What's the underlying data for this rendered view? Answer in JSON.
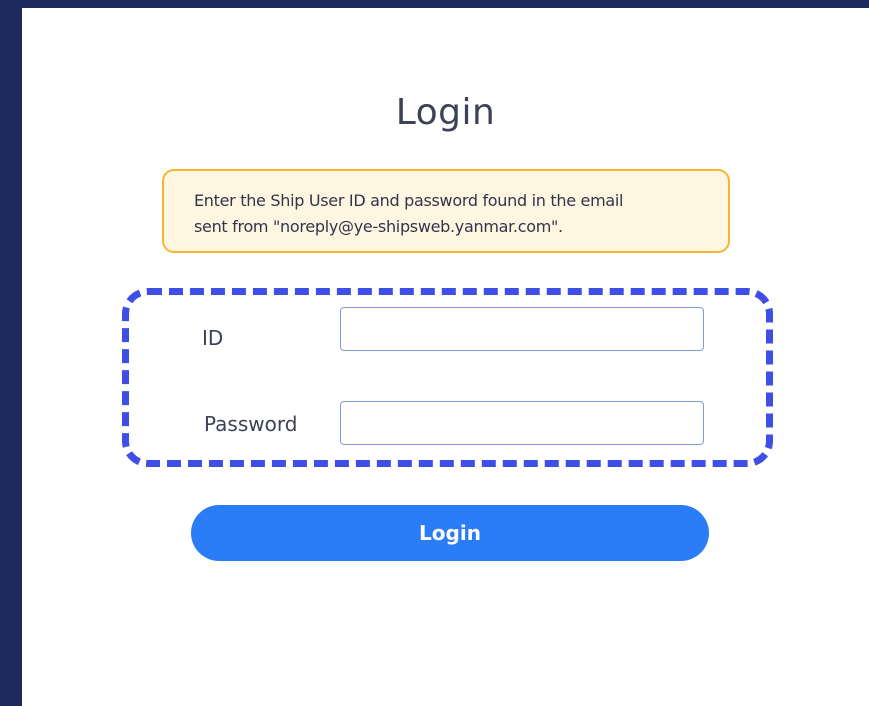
{
  "login": {
    "title": "Login",
    "notice_line1": "Enter the Ship User ID and password found in the email",
    "notice_line2": "sent from \"noreply@ye-shipsweb.yanmar.com\".",
    "id_label": "ID",
    "id_value": "",
    "password_label": "Password",
    "password_value": "",
    "button_label": "Login"
  },
  "colors": {
    "background": "#1c2a5e",
    "notice_border": "#f5b731",
    "notice_fill": "#fff6e2",
    "highlight_dash": "#3f4fe6",
    "button": "#2b7df7"
  }
}
